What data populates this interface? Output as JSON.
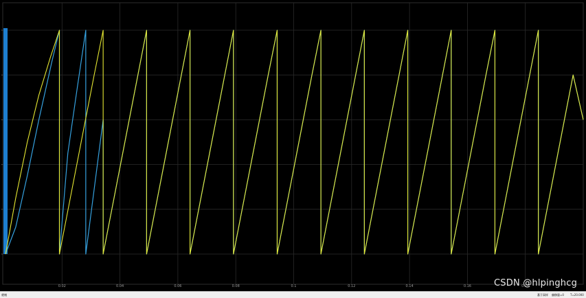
{
  "chart_data": {
    "type": "line",
    "title": "",
    "xlabel": "",
    "ylabel": "",
    "xlim": [
      0,
      0.2
    ],
    "ylim": [
      0,
      1.0
    ],
    "grid": true,
    "x_ticks": [
      "0.02",
      "0.04",
      "0.06",
      "0.08",
      "0.1",
      "0.12",
      "0.14",
      "0.16",
      "0.18"
    ],
    "x_tick_values": [
      0.02,
      0.04,
      0.06,
      0.08,
      0.1,
      0.12,
      0.14,
      0.16,
      0.18
    ],
    "y_tick_values": [
      0.0,
      0.2,
      0.4,
      0.6,
      0.8,
      1.0
    ],
    "series": [
      {
        "color": "#e6e832",
        "x": [
          0.0005,
          0.004,
          0.008,
          0.012,
          0.016,
          0.0191,
          0.0191,
          0.0221,
          0.0251,
          0.0281,
          0.0311,
          0.0342,
          0.0342,
          0.0372,
          0.0402,
          0.0432,
          0.0462,
          0.0492,
          0.0492,
          0.0522,
          0.0552,
          0.0582,
          0.0612,
          0.0642,
          0.0642,
          0.0672,
          0.0702,
          0.0732,
          0.0762,
          0.0792,
          0.0792,
          0.0822,
          0.0852,
          0.0882,
          0.0912,
          0.0943,
          0.0943,
          0.0973,
          0.1003,
          0.1033,
          0.1063,
          0.1094,
          0.1094,
          0.1124,
          0.1154,
          0.1184,
          0.1214,
          0.1244,
          0.1244,
          0.1274,
          0.1304,
          0.1334,
          0.1364,
          0.1394,
          0.1394,
          0.1424,
          0.1454,
          0.1484,
          0.1514,
          0.1544,
          0.1544,
          0.1574,
          0.1604,
          0.1634,
          0.1664,
          0.1695,
          0.1695,
          0.1725,
          0.1755,
          0.1785,
          0.1815,
          0.1845,
          0.1845,
          0.1875,
          0.1905,
          0.1935,
          0.1965,
          0.2
        ],
        "y": [
          0.0,
          0.25,
          0.5,
          0.71,
          0.88,
          1.0,
          0.0,
          0.2,
          0.4,
          0.6,
          0.8,
          1.0,
          0.0,
          0.2,
          0.4,
          0.6,
          0.8,
          1.0,
          0.0,
          0.2,
          0.4,
          0.6,
          0.8,
          1.0,
          0.0,
          0.2,
          0.4,
          0.6,
          0.8,
          1.0,
          0.0,
          0.2,
          0.4,
          0.6,
          0.8,
          1.0,
          0.0,
          0.2,
          0.4,
          0.6,
          0.8,
          1.0,
          0.0,
          0.2,
          0.4,
          0.6,
          0.8,
          1.0,
          0.0,
          0.2,
          0.4,
          0.6,
          0.8,
          1.0,
          0.0,
          0.2,
          0.4,
          0.6,
          0.8,
          1.0,
          0.0,
          0.2,
          0.4,
          0.6,
          0.8,
          1.0,
          0.0,
          0.2,
          0.4,
          0.6,
          0.8,
          1.0,
          0.0,
          0.2,
          0.4,
          0.6,
          0.8,
          0.6
        ]
      },
      {
        "color": "#36a2e0",
        "x": [
          0.0005,
          0.004,
          0.008,
          0.012,
          0.0165,
          0.0191,
          0.0191,
          0.022,
          0.025,
          0.0282,
          0.0282,
          0.0312,
          0.0342,
          0.0342,
          0.0372,
          0.0402,
          0.0432,
          0.0462,
          0.0492,
          0.0492,
          0.0522,
          0.0552,
          0.0582,
          0.0612,
          0.0642,
          0.0642,
          0.0672,
          0.0702,
          0.0732,
          0.0762,
          0.0792,
          0.0792,
          0.0822,
          0.0852,
          0.0882,
          0.0912,
          0.0943,
          0.0943,
          0.0973,
          0.1003,
          0.1033,
          0.1063,
          0.1094,
          0.1094,
          0.1124,
          0.1154,
          0.1184,
          0.1214,
          0.1244,
          0.1244,
          0.1274,
          0.1304,
          0.1334,
          0.1364,
          0.1394,
          0.1394,
          0.1424,
          0.1454,
          0.1484,
          0.1514,
          0.1544,
          0.1544,
          0.1574,
          0.1604,
          0.1634,
          0.1664,
          0.1695,
          0.1695,
          0.1725,
          0.1755,
          0.1785,
          0.1815,
          0.1845,
          0.1845,
          0.1875,
          0.1905,
          0.1935,
          0.1965,
          0.2
        ],
        "y": [
          0.0,
          0.12,
          0.35,
          0.6,
          0.86,
          1.0,
          0.0,
          0.45,
          0.72,
          1.0,
          0.0,
          0.3,
          0.6,
          0.0,
          0.2,
          0.4,
          0.6,
          0.8,
          1.0,
          0.0,
          0.2,
          0.4,
          0.6,
          0.8,
          1.0,
          0.0,
          0.2,
          0.4,
          0.6,
          0.8,
          1.0,
          0.0,
          0.2,
          0.4,
          0.6,
          0.8,
          1.0,
          0.0,
          0.2,
          0.4,
          0.6,
          0.8,
          1.0,
          0.0,
          0.2,
          0.4,
          0.6,
          0.8,
          1.0,
          0.0,
          0.2,
          0.4,
          0.6,
          0.8,
          1.0,
          0.0,
          0.2,
          0.4,
          0.6,
          0.8,
          1.0,
          0.0,
          0.2,
          0.4,
          0.6,
          0.8,
          1.0,
          0.0,
          0.2,
          0.4,
          0.6,
          0.8,
          1.0,
          0.0,
          0.2,
          0.4,
          0.6,
          0.8,
          0.6
        ]
      }
    ],
    "annotations": {
      "marker_color": "#1e7fd0"
    }
  },
  "watermark": "CSDN @hlpinghcg",
  "statusbar": {
    "left": "就绪",
    "sample": "基于采样",
    "offset": "偏移量=0",
    "time": "T=20.000"
  }
}
